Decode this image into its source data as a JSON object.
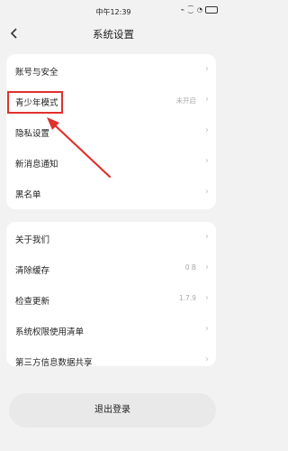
{
  "status_bar": {
    "time": "中午12:39",
    "icons": "⌁ ⁐ ◔",
    "battery_icon": "battery-icon"
  },
  "header": {
    "title": "系统设置",
    "back_icon": "chevron-left-icon"
  },
  "group1": [
    {
      "label": "账号与安全",
      "value": ""
    },
    {
      "label": "青少年模式",
      "value": "未开启"
    },
    {
      "label": "隐私设置",
      "value": ""
    },
    {
      "label": "新消息通知",
      "value": ""
    },
    {
      "label": "黑名单",
      "value": ""
    }
  ],
  "group2": [
    {
      "label": "关于我们",
      "value": ""
    },
    {
      "label": "清除缓存",
      "value": "0 B"
    },
    {
      "label": "检查更新",
      "value": "1.7.9"
    },
    {
      "label": "系统权限使用清单",
      "value": ""
    },
    {
      "label": "第三方信息数据共享",
      "value": ""
    }
  ],
  "chevron": "›",
  "logout_label": "退出登录",
  "annotation_color": "#e0312d"
}
